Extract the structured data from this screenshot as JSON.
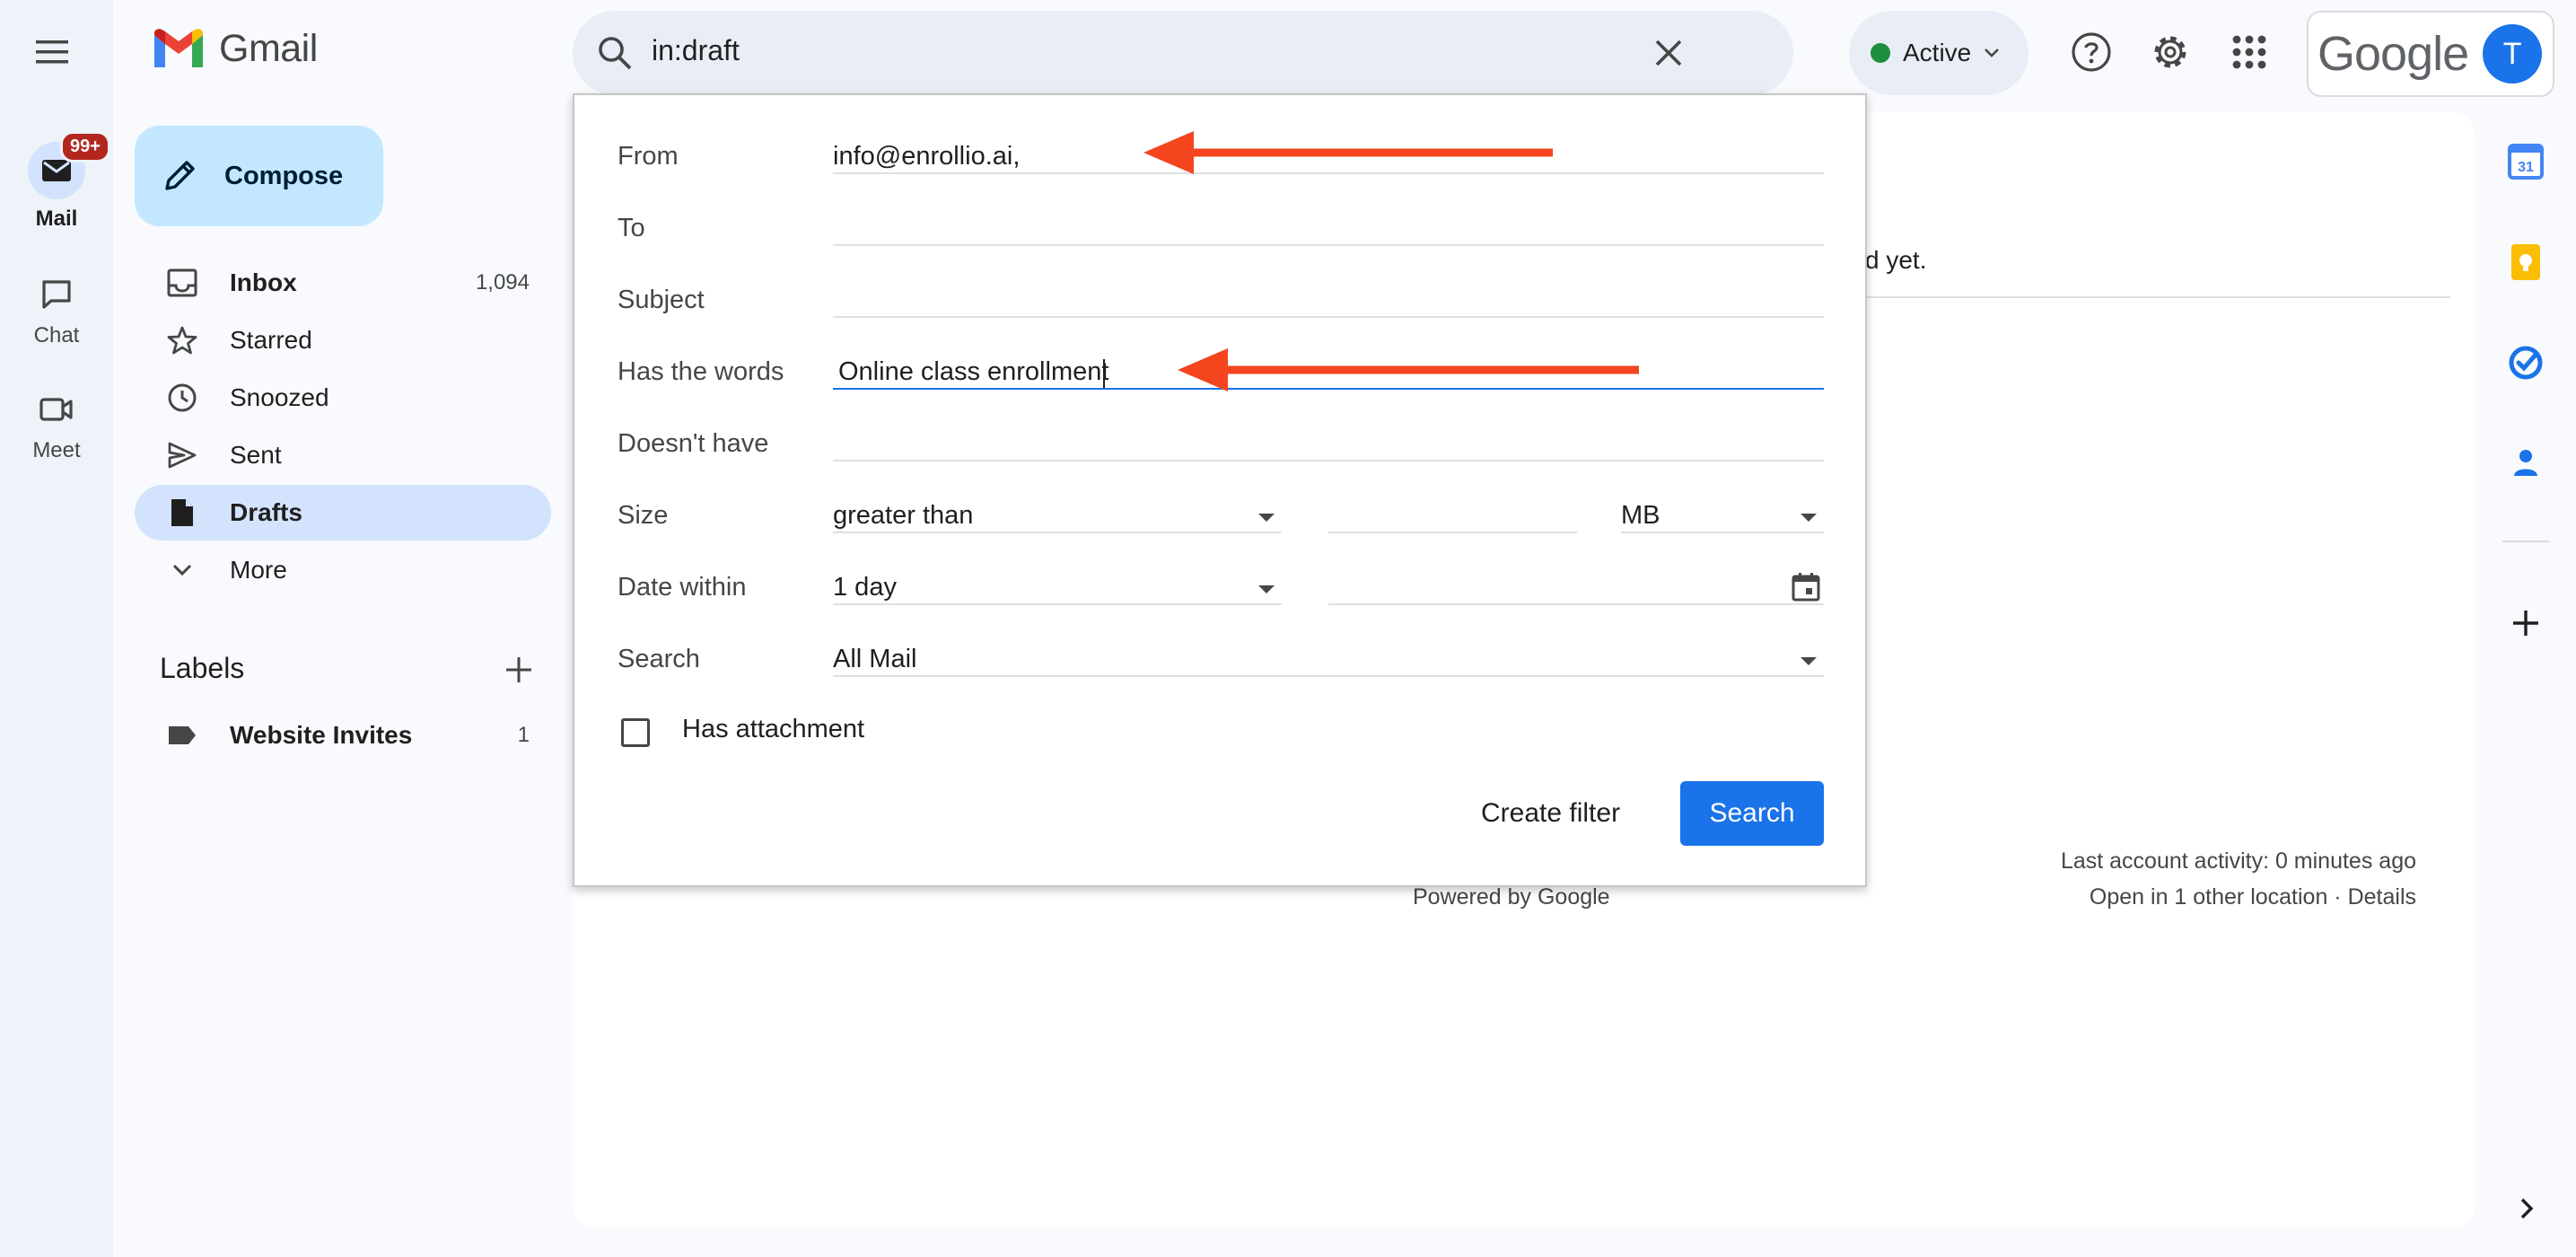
{
  "app": {
    "name": "Gmail",
    "google_word": "Google",
    "avatar_initial": "T"
  },
  "rail": {
    "mail_label": "Mail",
    "mail_badge": "99+",
    "chat_label": "Chat",
    "meet_label": "Meet"
  },
  "compose_label": "Compose",
  "nav": {
    "inbox": {
      "label": "Inbox",
      "count": "1,094"
    },
    "starred": {
      "label": "Starred"
    },
    "snoozed": {
      "label": "Snoozed"
    },
    "sent": {
      "label": "Sent"
    },
    "drafts": {
      "label": "Drafts"
    },
    "more": {
      "label": "More"
    }
  },
  "labels": {
    "title": "Labels",
    "items": [
      {
        "label": "Website Invites",
        "count": "1"
      }
    ]
  },
  "search": {
    "query": "in:draft"
  },
  "status": {
    "label": "Active",
    "color": "#1e8e3e"
  },
  "background": {
    "partial_text": "d yet.",
    "powered_by": "Powered by Google",
    "last_activity": "Last account activity: 0 minutes ago",
    "other_location": "Open in 1 other location · Details"
  },
  "advanced_search": {
    "from_label": "From",
    "from_value": "info@enrollio.ai,",
    "to_label": "To",
    "to_value": "",
    "subject_label": "Subject",
    "subject_value": "",
    "has_words_label": "Has the words",
    "has_words_value": "Online class enrollment",
    "doesnt_have_label": "Doesn't have",
    "doesnt_have_value": "",
    "size_label": "Size",
    "size_operator": "greater than",
    "size_value": "",
    "size_unit": "MB",
    "date_label": "Date within",
    "date_value": "1 day",
    "date_input": "",
    "search_label": "Search",
    "search_scope": "All Mail",
    "attachment_label": "Has attachment",
    "attachment_checked": false,
    "create_filter_label": "Create filter",
    "search_button_label": "Search"
  },
  "colors": {
    "accent": "#1a73e8",
    "annotation_arrow": "#f4451f",
    "compose_bg": "#c2e7ff",
    "active_nav_bg": "#d3e3fd"
  }
}
